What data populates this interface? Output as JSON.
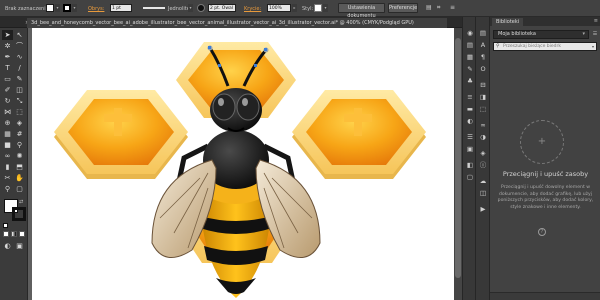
{
  "control_bar": {
    "mode_label": "Brak zaznaczenia",
    "stroke_label": "Obrys:",
    "stroke_weight": "1 pt",
    "profile_label": "Jednolite",
    "brush_label": "2 pt. Owal",
    "opacity_label": "Krycie:",
    "opacity_value": "100%",
    "style_label": "Styl:",
    "doc_setup_button": "Ustawienia dokumentu",
    "preferences_button": "Preferencje"
  },
  "document": {
    "tab_title": "3d_bee_and_honeycomb_vector_bee_ai_adobe_illustrator_bee_vector_animal_illustrator_vector_ai_3d_illustrator_vector.ai* @ 400% (CMYK/Podgląd GPU)"
  },
  "libraries": {
    "panel_title": "Biblioteki",
    "library_name": "Moja biblioteka",
    "search_placeholder": "Przeszukaj bieżące biedrk",
    "drop_heading": "Przeciągnij i upuść zasoby",
    "drop_description": "Przeciągnij i upuść dowolny element w dokumencie, aby dodać grafikę, lub użyj poniższych przycisków, aby dodać kolory, style znakowe i inne elementy."
  },
  "colors": {
    "ui_dark": "#323232",
    "accent": "#e89a3c",
    "honey_light": "#fde9a3",
    "honey_orange": "#f4a21c",
    "bee_yellow": "#f5b21a",
    "bee_black": "#111111"
  }
}
